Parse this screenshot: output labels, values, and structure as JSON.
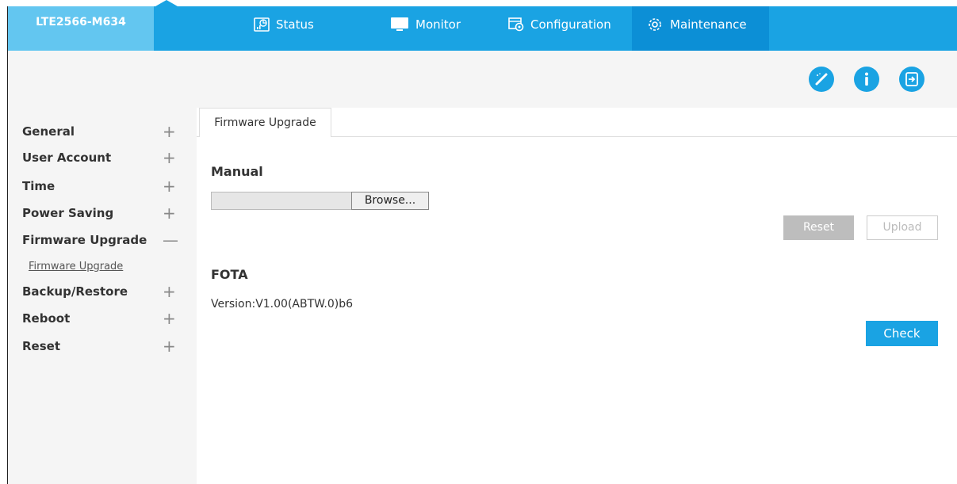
{
  "header": {
    "brand": "LTE2566-M634",
    "nav": [
      {
        "label": "Status",
        "icon": "status-icon"
      },
      {
        "label": "Monitor",
        "icon": "monitor-icon"
      },
      {
        "label": "Configuration",
        "icon": "configuration-icon"
      },
      {
        "label": "Maintenance",
        "icon": "maintenance-icon",
        "active": true
      }
    ],
    "tools": [
      "wizard-icon",
      "info-icon",
      "logout-icon"
    ]
  },
  "sidebar": {
    "items": [
      {
        "label": "General",
        "expander": "+"
      },
      {
        "label": "User Account",
        "expander": "+"
      },
      {
        "label": "Time",
        "expander": "+"
      },
      {
        "label": "Power Saving",
        "expander": "+"
      },
      {
        "label": "Firmware Upgrade",
        "expander": "—",
        "sub": [
          "Firmware Upgrade"
        ]
      },
      {
        "label": "Backup/Restore",
        "expander": "+"
      },
      {
        "label": "Reboot",
        "expander": "+"
      },
      {
        "label": "Reset",
        "expander": "+"
      }
    ]
  },
  "main": {
    "tab": "Firmware Upgrade",
    "manual": {
      "title": "Manual",
      "browse_label": "Browse...",
      "reset_label": "Reset",
      "upload_label": "Upload"
    },
    "fota": {
      "title": "FOTA",
      "version": "Version:V1.00(ABTW.0)b6",
      "check_label": "Check"
    }
  },
  "colors": {
    "accent": "#1aa3e3",
    "accent_dark": "#0c8fd6",
    "brand_bg": "#63c6f0",
    "sidebar_bg": "#f5f5f5"
  }
}
